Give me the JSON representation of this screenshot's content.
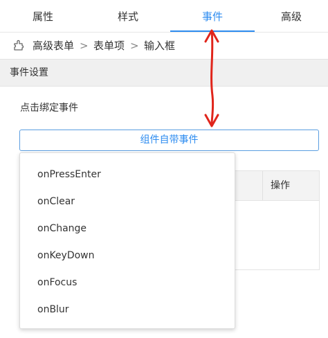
{
  "tabs": [
    {
      "label": "属性",
      "active": false
    },
    {
      "label": "样式",
      "active": false
    },
    {
      "label": "事件",
      "active": true
    },
    {
      "label": "高级",
      "active": false
    }
  ],
  "breadcrumb": {
    "icon": "puzzle-icon",
    "items": [
      "高级表单",
      "表单项",
      "输入框"
    ],
    "separator": ">"
  },
  "section": {
    "title": "事件设置"
  },
  "bind_label": "点击绑定事件",
  "event_select": {
    "value": "组件自带事件"
  },
  "table": {
    "columns": [
      "操作"
    ]
  },
  "dropdown": {
    "items": [
      "onPressEnter",
      "onClear",
      "onChange",
      "onKeyDown",
      "onFocus",
      "onBlur"
    ]
  },
  "annotation": {
    "type": "double-arrow",
    "color": "#e0251b"
  },
  "colors": {
    "accent": "#2d8cf0",
    "annotation": "#e0251b"
  }
}
